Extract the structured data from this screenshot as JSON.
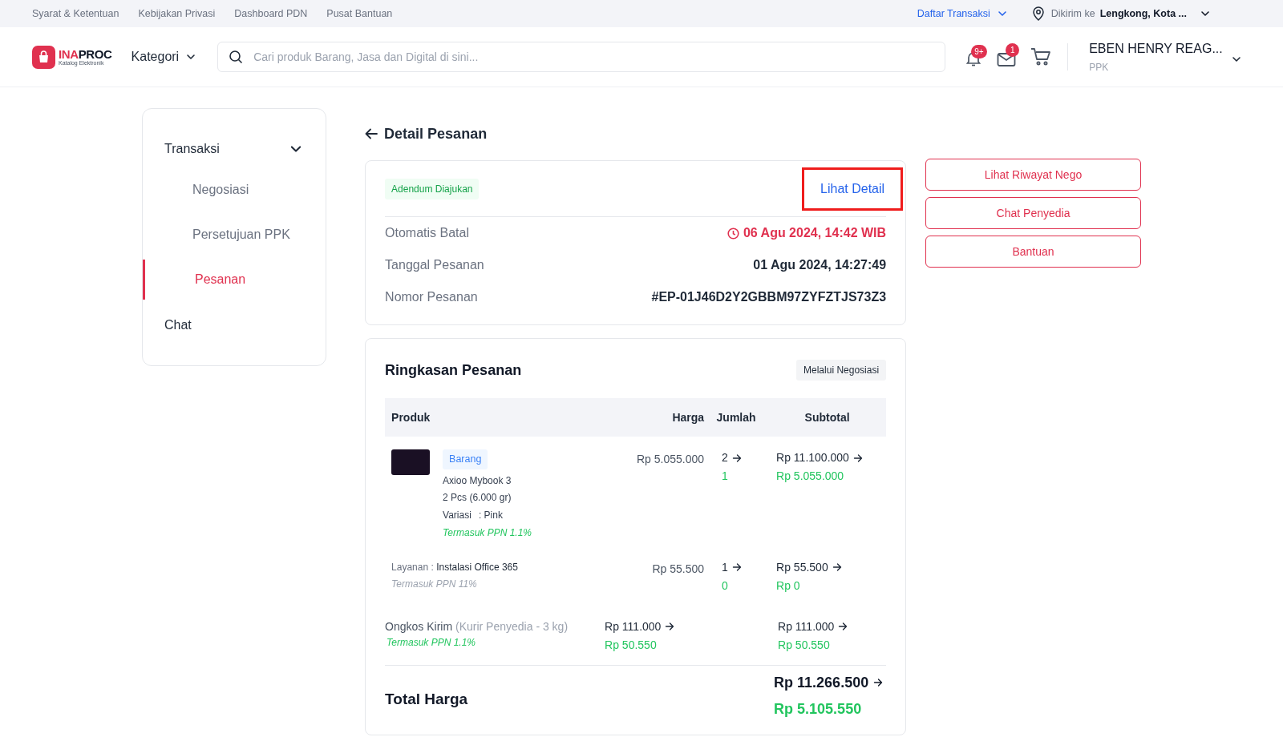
{
  "top_links": [
    "Syarat & Ketentuan",
    "Kebijakan Privasi",
    "Dashboard PDN",
    "Pusat Bantuan"
  ],
  "top_right": {
    "transactions_link": "Daftar Transaksi",
    "ship_label": "Dikirim ke",
    "ship_location": "Lengkong, Kota ..."
  },
  "header": {
    "logo": {
      "accent": "INA",
      "rest": "PROC",
      "subtitle": "Katalog Elektronik"
    },
    "category": "Kategori",
    "search_placeholder": "Cari produk Barang, Jasa dan Digital di sini...",
    "notification_badge": "9+",
    "mail_badge": "1",
    "user_name": "EBEN HENRY REAG...",
    "user_role": "PPK"
  },
  "sidebar": {
    "group": {
      "label": "Transaksi",
      "expanded": true,
      "items": [
        {
          "label": "Negosiasi",
          "selected": false
        },
        {
          "label": "Persetujuan PPK",
          "selected": false
        },
        {
          "label": "Pesanan",
          "selected": true
        }
      ]
    },
    "items": [
      {
        "label": "Chat",
        "selected": false
      }
    ]
  },
  "page_title": "Detail Pesanan",
  "order_card": {
    "status_tag": "Adendum Diajukan",
    "detail_link": {
      "label": "Lihat Detail",
      "highlighted": true
    },
    "fields": [
      {
        "label": "Otomatis Batal",
        "value": "06 Agu 2024, 14:42 WIB",
        "kind": "deadline"
      },
      {
        "label": "Tanggal Pesanan",
        "value": "01 Agu 2024, 14:27:49",
        "kind": "plain"
      },
      {
        "label": "Nomor Pesanan",
        "value": "#EP-01J46D2Y2GBBM97ZYFZTJS73Z3",
        "kind": "plain"
      }
    ]
  },
  "actions": [
    "Lihat Riwayat Nego",
    "Chat Penyedia",
    "Bantuan"
  ],
  "summary": {
    "title": "Ringkasan Pesanan",
    "method_tag": "Melalui Negosiasi",
    "columns": [
      "Produk",
      "Harga",
      "Jumlah",
      "Subtotal"
    ],
    "product": {
      "tag": "Barang",
      "name": "Axioo Mybook 3",
      "quantity": "2 Pcs (6.000 gr)",
      "variant_label": "Variasi",
      "variant_value": ": Pink",
      "tax_note": "Termasuk PPN 1.1%",
      "price": "Rp 5.055.000",
      "qty_old": "2",
      "qty_new": "1",
      "subtotal_old": "Rp 11.100.000",
      "subtotal_new": "Rp 5.055.000"
    },
    "service": {
      "label": "Layanan :",
      "name": "Instalasi Office 365",
      "tax_note": "Termasuk PPN 11%",
      "price": "Rp 55.500",
      "qty_old": "1",
      "qty_new": "0",
      "subtotal_old": "Rp 55.500",
      "subtotal_new": "Rp 0"
    },
    "shipping": {
      "label": "Ongkos Kirim",
      "detail": "(Kurir Penyedia - 3 kg)",
      "tax_note": "Termasuk PPN 1.1%",
      "price_old": "Rp 111.000",
      "price_new": "Rp 50.550",
      "subtotal_old": "Rp 111.000",
      "subtotal_new": "Rp 50.550"
    },
    "total": {
      "label": "Total Harga",
      "old": "Rp 11.266.500",
      "new": "Rp 5.105.550"
    }
  }
}
